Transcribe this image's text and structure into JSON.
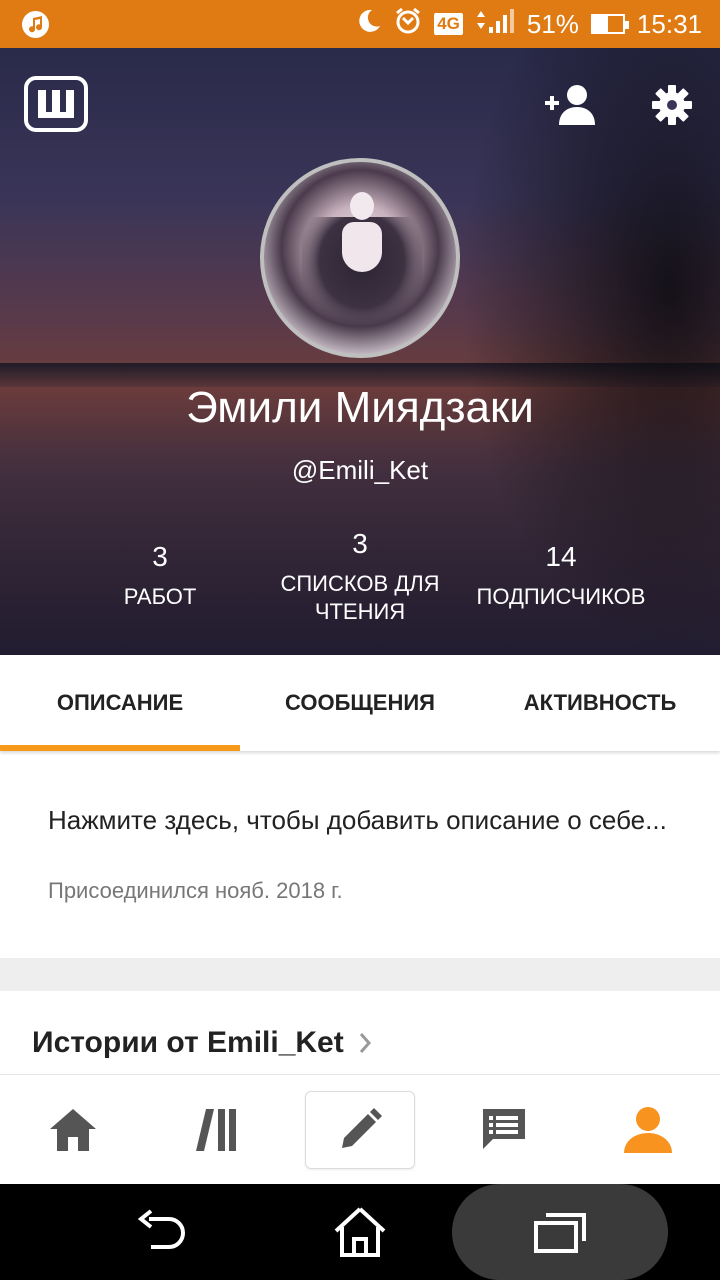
{
  "status_bar": {
    "network": "4G",
    "battery": "51%",
    "battery_level": 0.51,
    "time": "15:31"
  },
  "header": {
    "logo_letter": "Ш",
    "name": "Эмили Миядзаки",
    "handle": "@Emili_Ket",
    "stats": [
      {
        "value": "3",
        "label": "РАБОТ"
      },
      {
        "value": "3",
        "label": "СПИСКОВ ДЛЯ ЧТЕНИЯ"
      },
      {
        "value": "14",
        "label": "ПОДПИСЧИКОВ"
      }
    ]
  },
  "tabs": [
    {
      "label": "ОПИСАНИЕ",
      "active": true
    },
    {
      "label": "СООБЩЕНИЯ",
      "active": false
    },
    {
      "label": "АКТИВНОСТЬ",
      "active": false
    }
  ],
  "about": {
    "description_prompt": "Нажмите здесь, чтобы добавить описание о себе...",
    "joined": "Присоединился нояб. 2018 г."
  },
  "stories": {
    "title": "Истории от Emili_Ket"
  },
  "colors": {
    "status_bar": "#e07a12",
    "accent": "#f79a1c",
    "nav_icon": "#555555",
    "profile_active": "#f7931e"
  },
  "icons": {
    "status_left": "music-note-icon",
    "status_right": [
      "moon-icon",
      "alarm-icon",
      "signal-icon",
      "battery-icon"
    ],
    "header_right": [
      "add-friend-icon",
      "settings-gear-icon"
    ],
    "bottom_nav": [
      "home-icon",
      "library-icon",
      "write-pencil-icon",
      "messages-icon",
      "profile-icon"
    ],
    "system_nav": [
      "back-icon",
      "home-outline-icon",
      "recents-icon"
    ]
  }
}
